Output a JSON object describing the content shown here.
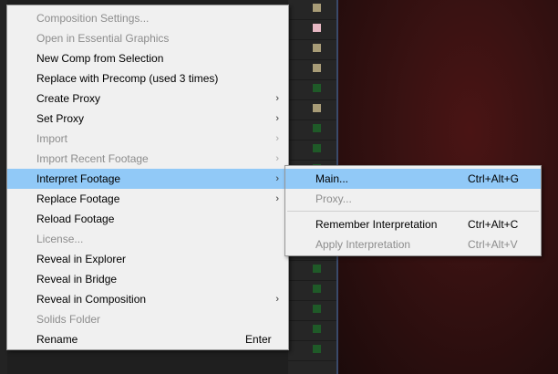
{
  "colors": {
    "menu_bg": "#f0f0f0",
    "highlight": "#91c9f7",
    "disabled_text": "#8d8d8d",
    "viewer_red": "#3a1212",
    "swatch_tan": "#a89c77",
    "swatch_pink": "#e7b8c3",
    "swatch_green": "#1f5a28"
  },
  "context_menu": {
    "items": [
      {
        "label": "Composition Settings...",
        "enabled": false,
        "submenu": false,
        "shortcut": ""
      },
      {
        "label": "Open in Essential Graphics",
        "enabled": false,
        "submenu": false,
        "shortcut": ""
      },
      {
        "label": "New Comp from Selection",
        "enabled": true,
        "submenu": false,
        "shortcut": ""
      },
      {
        "label": "Replace with Precomp (used 3 times)",
        "enabled": true,
        "submenu": false,
        "shortcut": ""
      },
      {
        "label": "Create Proxy",
        "enabled": true,
        "submenu": true,
        "shortcut": ""
      },
      {
        "label": "Set Proxy",
        "enabled": true,
        "submenu": true,
        "shortcut": ""
      },
      {
        "label": "Import",
        "enabled": false,
        "submenu": true,
        "shortcut": ""
      },
      {
        "label": "Import Recent Footage",
        "enabled": false,
        "submenu": true,
        "shortcut": ""
      },
      {
        "label": "Interpret Footage",
        "enabled": true,
        "submenu": true,
        "shortcut": "",
        "highlighted": true
      },
      {
        "label": "Replace Footage",
        "enabled": true,
        "submenu": true,
        "shortcut": ""
      },
      {
        "label": "Reload Footage",
        "enabled": true,
        "submenu": false,
        "shortcut": ""
      },
      {
        "label": "License...",
        "enabled": false,
        "submenu": false,
        "shortcut": ""
      },
      {
        "label": "Reveal in Explorer",
        "enabled": true,
        "submenu": false,
        "shortcut": ""
      },
      {
        "label": "Reveal in Bridge",
        "enabled": true,
        "submenu": false,
        "shortcut": ""
      },
      {
        "label": "Reveal in Composition",
        "enabled": true,
        "submenu": true,
        "shortcut": ""
      },
      {
        "label": "Solids Folder",
        "enabled": false,
        "submenu": false,
        "shortcut": ""
      },
      {
        "label": "Rename",
        "enabled": true,
        "submenu": false,
        "shortcut": "Enter"
      }
    ],
    "submenu_arrow": "›"
  },
  "interpret_submenu": {
    "items": [
      {
        "label": "Main...",
        "shortcut": "Ctrl+Alt+G",
        "enabled": true,
        "highlighted": true
      },
      {
        "label": "Proxy...",
        "shortcut": "",
        "enabled": false
      },
      {
        "separator": true
      },
      {
        "label": "Remember Interpretation",
        "shortcut": "Ctrl+Alt+C",
        "enabled": true
      },
      {
        "label": "Apply Interpretation",
        "shortcut": "Ctrl+Alt+V",
        "enabled": false
      }
    ]
  },
  "background": {
    "label_swatches": [
      "tan",
      "pink",
      "tan",
      "tan",
      "green",
      "tan",
      "green",
      "green",
      "green",
      "green",
      "green",
      "green",
      "green",
      "green",
      "green",
      "green",
      "green",
      "green"
    ]
  }
}
